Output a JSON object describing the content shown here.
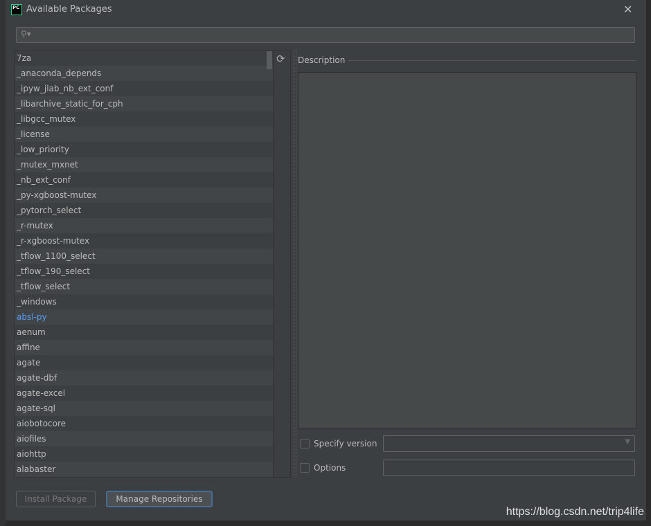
{
  "window": {
    "title": "Available Packages",
    "close": "✕",
    "logo": "PC"
  },
  "search": {
    "placeholder": "",
    "icon": "search-icon"
  },
  "packages": [
    "7za",
    "_anaconda_depends",
    "_ipyw_jlab_nb_ext_conf",
    "_libarchive_static_for_cph",
    "_libgcc_mutex",
    "_license",
    "_low_priority",
    "_mutex_mxnet",
    "_nb_ext_conf",
    "_py-xgboost-mutex",
    "_pytorch_select",
    "_r-mutex",
    "_r-xgboost-mutex",
    "_tflow_1100_select",
    "_tflow_190_select",
    "_tflow_select",
    "_windows",
    "absl-py",
    "aenum",
    "affine",
    "agate",
    "agate-dbf",
    "agate-excel",
    "agate-sql",
    "aiobotocore",
    "aiofiles",
    "aiohttp",
    "alabaster"
  ],
  "highlighted_package": "absl-py",
  "description": {
    "label": "Description"
  },
  "options": {
    "specify_version": "Specify version",
    "options": "Options"
  },
  "buttons": {
    "install": "Install Package",
    "manage": "Manage Repositories"
  },
  "watermark": "https://blog.csdn.net/trip4life",
  "colors": {
    "link": "#589df6",
    "accent": "#466d94"
  }
}
